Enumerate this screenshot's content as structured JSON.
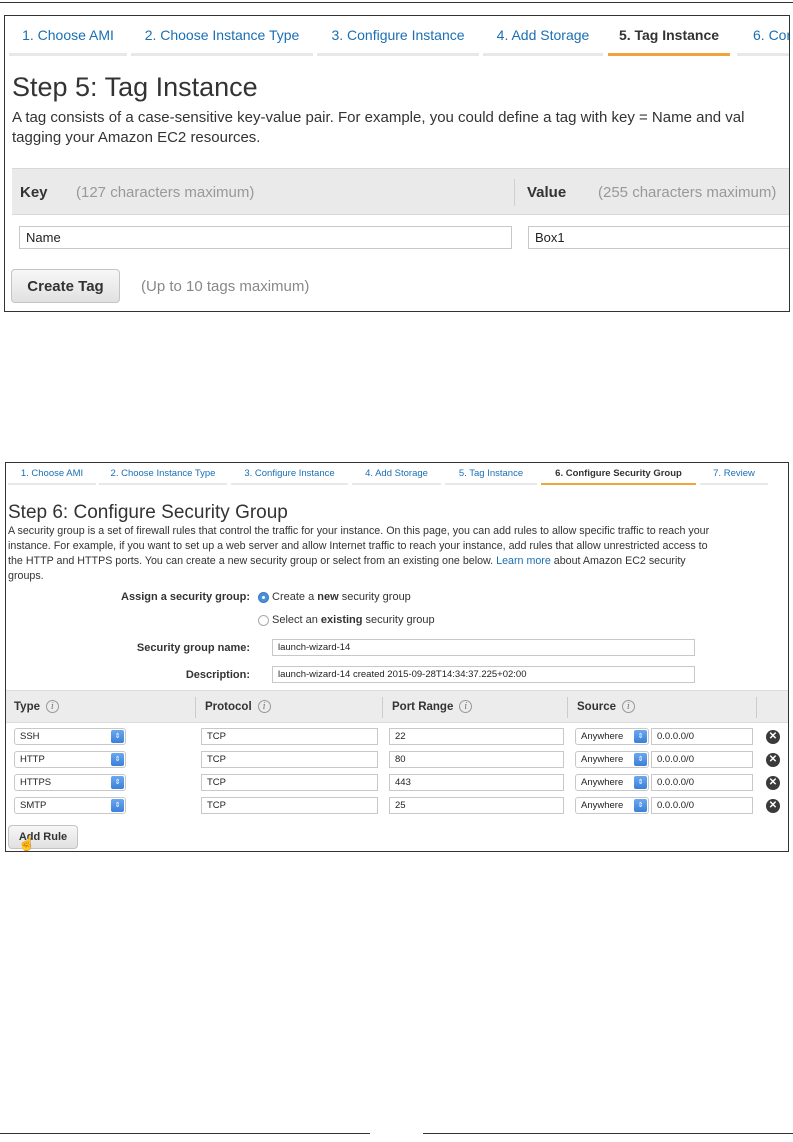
{
  "shot1": {
    "tabs": [
      {
        "label": "1. Choose AMI",
        "active": false
      },
      {
        "label": "2. Choose Instance Type",
        "active": false
      },
      {
        "label": "3. Configure Instance",
        "active": false
      },
      {
        "label": "4. Add Storage",
        "active": false
      },
      {
        "label": "5. Tag Instance",
        "active": true
      },
      {
        "label": "6. Con",
        "active": false
      }
    ],
    "title": "Step 5: Tag Instance",
    "description_line1": "A tag consists of a case-sensitive key-value pair. For example, you could define a tag with key = Name and val",
    "description_line2": "tagging your Amazon EC2 resources.",
    "key_header": "Key",
    "key_hint": "(127 characters maximum)",
    "value_header": "Value",
    "value_hint": "(255 characters maximum)",
    "key_value": "Name",
    "value_value": "Box1",
    "create_tag_label": "Create Tag",
    "create_tag_hint": "(Up to 10 tags maximum)"
  },
  "shot2": {
    "tabs": [
      {
        "label": "1. Choose AMI",
        "active": false
      },
      {
        "label": "2. Choose Instance Type",
        "active": false
      },
      {
        "label": "3. Configure Instance",
        "active": false
      },
      {
        "label": "4. Add Storage",
        "active": false
      },
      {
        "label": "5. Tag Instance",
        "active": false
      },
      {
        "label": "6. Configure Security Group",
        "active": true
      },
      {
        "label": "7. Review",
        "active": false
      }
    ],
    "title": "Step 6: Configure Security Group",
    "description_lines": [
      "A security group is a set of firewall rules that control the traffic for your instance. On this page, you can add rules to allow specific traffic to reach your",
      "instance. For example, if you want to set up a web server and allow Internet traffic to reach your instance, add rules that allow unrestricted access to",
      "the HTTP and HTTPS ports. You can create a new security group or select from an existing one below."
    ],
    "learn_more": "Learn more",
    "description_tail": " about Amazon EC2 security",
    "description_last": "groups.",
    "assign_label": "Assign a security group:",
    "option_new_pre": "Create a ",
    "option_new_bold": "new",
    "option_new_post": " security group",
    "option_existing_pre": "Select an ",
    "option_existing_bold": "existing",
    "option_existing_post": " security group",
    "name_label": "Security group name:",
    "name_value": "launch-wizard-14",
    "desc_label": "Description:",
    "desc_value": "launch-wizard-14 created 2015-09-28T14:34:37.225+02:00",
    "columns": [
      "Type",
      "Protocol",
      "Port Range",
      "Source"
    ],
    "rules": [
      {
        "type": "SSH",
        "protocol": "TCP",
        "port": "22",
        "source": "Anywhere",
        "cidr": "0.0.0.0/0"
      },
      {
        "type": "HTTP",
        "protocol": "TCP",
        "port": "80",
        "source": "Anywhere",
        "cidr": "0.0.0.0/0"
      },
      {
        "type": "HTTPS",
        "protocol": "TCP",
        "port": "443",
        "source": "Anywhere",
        "cidr": "0.0.0.0/0"
      },
      {
        "type": "SMTP",
        "protocol": "TCP",
        "port": "25",
        "source": "Anywhere",
        "cidr": "0.0.0.0/0"
      }
    ],
    "add_rule_label": "Add Rule"
  },
  "icons": {
    "info": "info-icon",
    "delete": "remove-circle-icon",
    "select_arrow": "select-arrows-icon",
    "cursor": "hand-pointer-icon"
  },
  "colors": {
    "link": "#1a6fb4",
    "active_tab_underline": "#f0a43b",
    "select_accent": "#3b7fd9"
  }
}
